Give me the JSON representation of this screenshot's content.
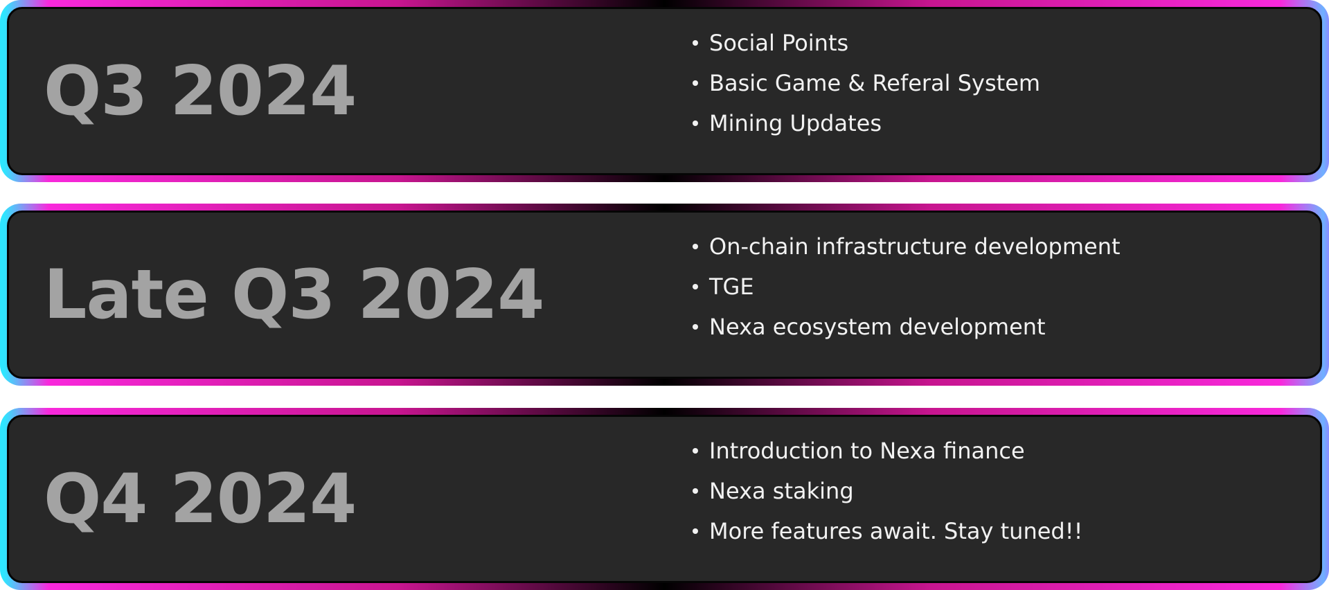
{
  "roadmap": [
    {
      "period": "Q3 2024",
      "items": [
        "Social Points",
        "Basic Game & Referal System",
        "Mining Updates"
      ]
    },
    {
      "period": "Late Q3 2024",
      "items": [
        "On-chain infrastructure development",
        "TGE",
        "Nexa ecosystem development"
      ]
    },
    {
      "period": "Q4 2024",
      "items": [
        "Introduction to Nexa finance",
        "Nexa staking",
        "More features await. Stay tuned!!"
      ]
    }
  ],
  "colors": {
    "card_background": "#282828",
    "period_text": "#a3a3a3",
    "item_text": "#f2f2f2",
    "border_pink": "#ff2be6",
    "border_cyan": "#2ee6ff",
    "border_blue": "#6fb0ff"
  }
}
